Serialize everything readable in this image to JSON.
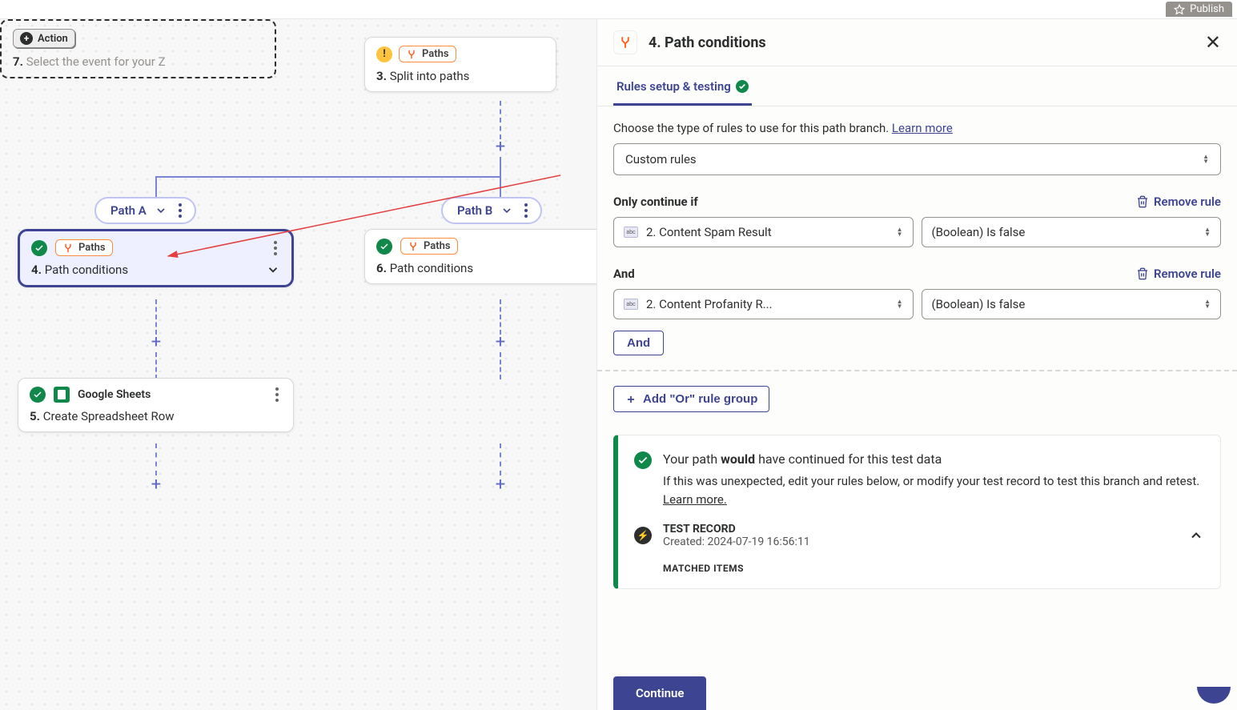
{
  "topbar": {
    "publish": "Publish"
  },
  "canvas": {
    "split_node": {
      "chip": "Paths",
      "num": "3.",
      "title": "Split into paths"
    },
    "path_a": {
      "label": "Path A"
    },
    "path_b": {
      "label": "Path B"
    },
    "cond_a": {
      "chip": "Paths",
      "num": "4.",
      "title": "Path conditions"
    },
    "cond_b": {
      "chip": "Paths",
      "num": "6.",
      "title": "Path conditions"
    },
    "sheets": {
      "app": "Google Sheets",
      "num": "5.",
      "title": "Create Spreadsheet Row"
    },
    "action": {
      "chip": "Action",
      "num": "7.",
      "title": "Select the event for your Z"
    }
  },
  "panel": {
    "title": "4. Path conditions",
    "tab": "Rules setup & testing",
    "desc": "Choose the type of rules to use for this path branch.",
    "learn": "Learn more",
    "select_value": "Custom rules",
    "only_continue": "Only continue if",
    "remove": "Remove rule",
    "rule1_field": "2. Content Spam Result",
    "rule1_cond": "(Boolean) Is false",
    "and_label": "And",
    "rule2_field": "2. Content Profanity R...",
    "rule2_cond": "(Boolean) Is false",
    "and_btn": "And",
    "or_btn": "Add \"Or\" rule group",
    "result_pre": "Your path ",
    "result_bold": "would",
    "result_post": " have continued for this test data",
    "result_desc": "If this was unexpected, edit your rules below, or modify your test record to test this branch and retest. ",
    "result_learn": "Learn more.",
    "test_title": "TEST RECORD",
    "test_created": "Created: 2024-07-19 16:56:11",
    "matched": "MATCHED ITEMS",
    "continue": "Continue"
  }
}
